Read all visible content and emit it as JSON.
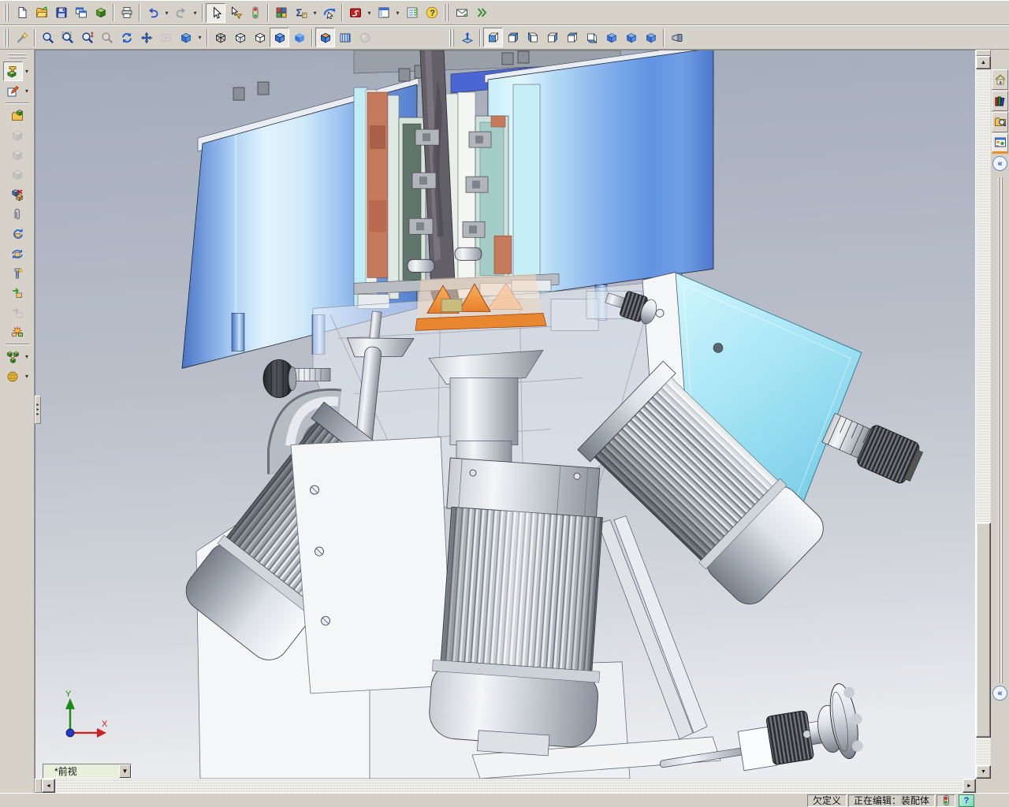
{
  "toolbar_row1": {
    "items": [
      {
        "t": "grip"
      },
      {
        "n": "new-document",
        "k": "page"
      },
      {
        "n": "open-document",
        "k": "folder"
      },
      {
        "n": "save",
        "k": "floppy"
      },
      {
        "n": "make-drawing-from-part",
        "k": "windows2"
      },
      {
        "n": "make-assembly-from-part",
        "k": "partbox"
      },
      {
        "t": "sep"
      },
      {
        "n": "print",
        "k": "printer"
      },
      {
        "t": "sep"
      },
      {
        "n": "undo",
        "k": "undo",
        "dd": true
      },
      {
        "n": "redo",
        "k": "redo",
        "s": "disabled",
        "dd": true
      },
      {
        "t": "sep"
      },
      {
        "n": "select",
        "k": "cursor",
        "s": "pressed"
      },
      {
        "n": "select-filter",
        "k": "cursorfilter"
      },
      {
        "n": "selection-filter-toggle",
        "k": "traffic"
      },
      {
        "t": "sep"
      },
      {
        "n": "edit-color",
        "k": "swatches"
      },
      {
        "n": "measure",
        "k": "sigma",
        "dd": true
      },
      {
        "n": "pointer-with-swoosh",
        "k": "swoosh"
      },
      {
        "t": "sep"
      },
      {
        "n": "solidworks-office",
        "k": "swbox",
        "dd": true
      },
      {
        "n": "window-layout",
        "k": "winpane",
        "dd": true
      },
      {
        "n": "task-checklist",
        "k": "checklist"
      },
      {
        "n": "help",
        "k": "helpq"
      },
      {
        "t": "grip"
      },
      {
        "n": "send-email",
        "k": "mail"
      },
      {
        "n": "hyperlinks",
        "k": "links"
      }
    ]
  },
  "toolbar_row2": {
    "items": [
      {
        "t": "grip"
      },
      {
        "n": "selection-wand",
        "k": "wand"
      },
      {
        "t": "sep"
      },
      {
        "n": "zoom-to-fit",
        "k": "magfit"
      },
      {
        "n": "zoom-to-area",
        "k": "magarea"
      },
      {
        "n": "zoom-in-out",
        "k": "maginout"
      },
      {
        "n": "zoom-to-selection",
        "k": "magsel",
        "s": "disabled"
      },
      {
        "n": "rotate-view",
        "k": "rotatecirc"
      },
      {
        "n": "pan-view",
        "k": "pan"
      },
      {
        "n": "previous-view",
        "k": "prevview",
        "s": "disabled"
      },
      {
        "n": "standard-views",
        "k": "cubestd",
        "dd": true
      },
      {
        "t": "sep"
      },
      {
        "n": "wireframe",
        "k": "cubewire"
      },
      {
        "n": "hidden-lines-visible",
        "k": "cubehlv"
      },
      {
        "n": "hidden-lines-removed",
        "k": "cubehlr"
      },
      {
        "n": "shaded-with-edges",
        "k": "cubeshadededge",
        "s": "pressed"
      },
      {
        "n": "shaded",
        "k": "cubeshaded"
      },
      {
        "t": "sep"
      },
      {
        "n": "section-view",
        "k": "cubesection",
        "s": "pressed"
      },
      {
        "n": "realview-graphics",
        "k": "curtain"
      },
      {
        "n": "perspective",
        "k": "sphere",
        "s": "disabled"
      },
      {
        "t": "gap"
      },
      {
        "t": "grip"
      },
      {
        "n": "normal-to",
        "k": "normalto"
      },
      {
        "t": "sep"
      },
      {
        "n": "front-view",
        "k": "vfront",
        "s": "pressed"
      },
      {
        "n": "back-view",
        "k": "vback"
      },
      {
        "n": "left-view",
        "k": "vleft"
      },
      {
        "n": "right-view",
        "k": "vright"
      },
      {
        "n": "top-view",
        "k": "vtop"
      },
      {
        "n": "bottom-view",
        "k": "vbottom"
      },
      {
        "n": "isometric-view",
        "k": "csolid"
      },
      {
        "n": "trimetric-view",
        "k": "csolid"
      },
      {
        "n": "dimetric-view",
        "k": "csolid"
      },
      {
        "t": "sep"
      },
      {
        "n": "camera-view",
        "k": "camera"
      }
    ]
  },
  "left_toolbar": {
    "items": [
      {
        "t": "grip"
      },
      {
        "n": "assembly-tools",
        "k": "asmmain",
        "s": "pressed",
        "dd": true
      },
      {
        "n": "sketch",
        "k": "sketch",
        "dd": true
      },
      {
        "t": "sep"
      },
      {
        "n": "insert-component",
        "k": "folderpart"
      },
      {
        "n": "new-part",
        "k": "graypart",
        "s": "disabled"
      },
      {
        "n": "new-assembly",
        "k": "graypart",
        "s": "disabled"
      },
      {
        "n": "edit-component",
        "k": "graypart",
        "s": "disabled"
      },
      {
        "n": "hide-component",
        "k": "asmx"
      },
      {
        "n": "attach-annotation",
        "k": "clip"
      },
      {
        "n": "reload-component",
        "k": "replay"
      },
      {
        "n": "rotate-component",
        "k": "rotcomp"
      },
      {
        "n": "smart-fasteners",
        "k": "screwstar"
      },
      {
        "n": "move-component",
        "k": "movecomp"
      },
      {
        "n": "move-with-triad",
        "k": "movegray",
        "s": "disabled"
      },
      {
        "n": "collision-detection",
        "k": "collision"
      },
      {
        "t": "sep"
      },
      {
        "n": "exploded-view",
        "k": "explode",
        "dd": true
      },
      {
        "n": "simulation",
        "k": "simsphere",
        "dd": true
      }
    ]
  },
  "task_pane": {
    "tabs": [
      {
        "n": "resources-home",
        "k": "home"
      },
      {
        "n": "design-library",
        "k": "books"
      },
      {
        "n": "file-explorer",
        "k": "foldersearch"
      },
      {
        "n": "custom-properties",
        "k": "palette",
        "s": "active"
      }
    ],
    "collapse_glyph": "«"
  },
  "viewport": {
    "view_label": "*前视",
    "dropdown_glyph": "▼",
    "triad": {
      "x_label": "X",
      "y_label": "Y",
      "x_color": "#cc2222",
      "y_color": "#1a8a1a",
      "origin_color": "#2238c8"
    }
  },
  "scrollbars": {
    "up": "▲",
    "down": "▼",
    "left": "◄",
    "right": "►"
  },
  "pane_split_arrows": "▸",
  "status_bar": {
    "constraint_state": "欠定义",
    "editing_mode": "正在编辑：装配体",
    "help_glyph": "?"
  },
  "colors": {
    "chrome": "#d6d2ca",
    "accent_blue": "#3a6cd8",
    "viewport_bg_top": "#a6aebc",
    "viewport_bg_bottom": "#e9ebee",
    "model_blue_cylinder": "#84b0ec",
    "model_light_cyan": "#c6eef9",
    "model_cyan_panel": "#a8e6f6",
    "model_copper": "#c57a5c",
    "model_orange_cone": "#e8873a",
    "model_silver": "#c8ccd3",
    "model_knurl_dark": "#4a4b51",
    "status_red": "#e02020",
    "status_green": "#30b030",
    "active_tab_orange": "#e8902a",
    "view_label_bg": "#e9efdb"
  }
}
